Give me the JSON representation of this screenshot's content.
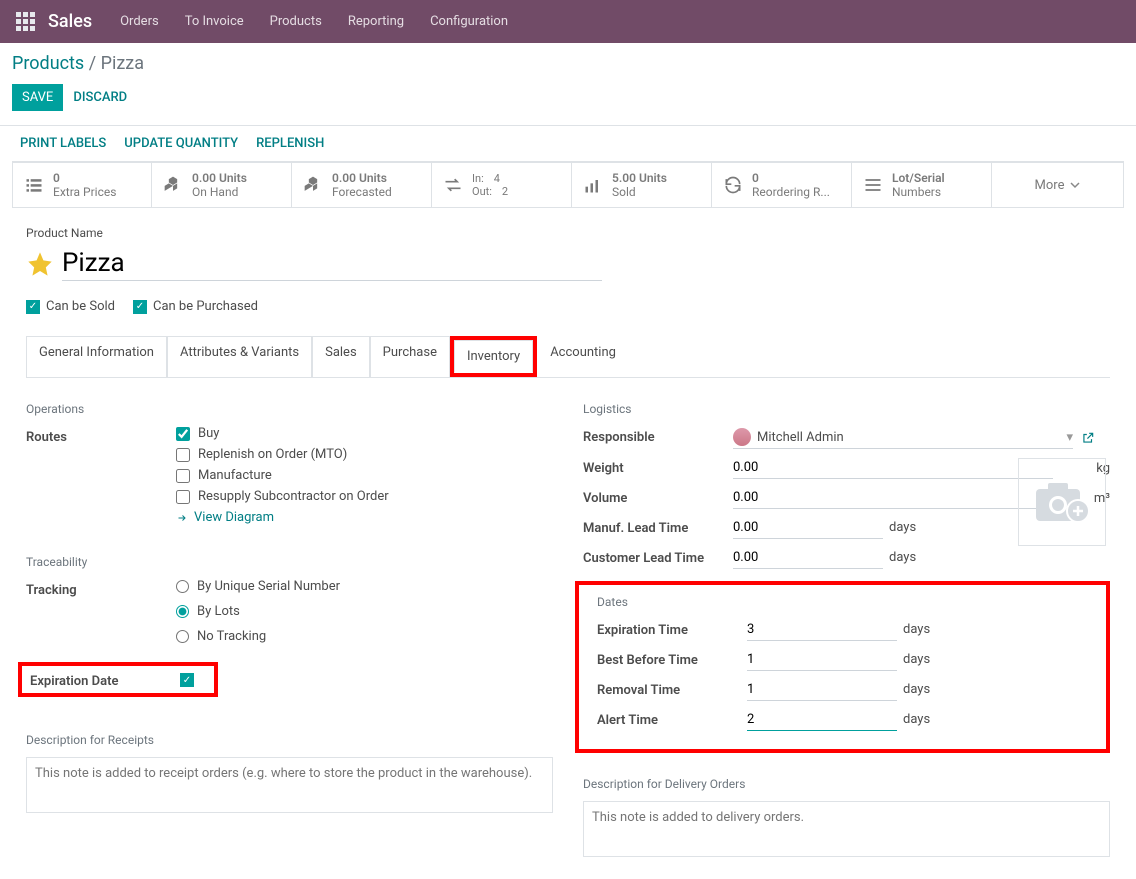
{
  "topbar": {
    "app_name": "Sales",
    "menu": [
      "Orders",
      "To Invoice",
      "Products",
      "Reporting",
      "Configuration"
    ]
  },
  "breadcrumb": {
    "parent": "Products",
    "current": "Pizza"
  },
  "buttons": {
    "save": "SAVE",
    "discard": "DISCARD"
  },
  "actions": {
    "print": "PRINT LABELS",
    "update": "UPDATE QUANTITY",
    "replenish": "REPLENISH"
  },
  "stats": {
    "extra_prices": {
      "v": "0",
      "l": "Extra Prices"
    },
    "on_hand": {
      "v": "0.00 Units",
      "l": "On Hand"
    },
    "forecasted": {
      "v": "0.00 Units",
      "l": "Forecasted"
    },
    "in_label": "In:",
    "in_v": "4",
    "out_label": "Out:",
    "out_v": "2",
    "sold": {
      "v": "5.00 Units",
      "l": "Sold"
    },
    "reorder": {
      "v": "0",
      "l": "Reordering R..."
    },
    "lot": {
      "v": "Lot/Serial",
      "l": "Numbers"
    },
    "more": "More"
  },
  "product": {
    "name_label": "Product Name",
    "name": "Pizza",
    "sold_label": "Can be Sold",
    "purchased_label": "Can be Purchased"
  },
  "tabs": [
    "General Information",
    "Attributes & Variants",
    "Sales",
    "Purchase",
    "Inventory",
    "Accounting"
  ],
  "operations": {
    "title": "Operations",
    "routes_label": "Routes",
    "buy": "Buy",
    "mto": "Replenish on Order (MTO)",
    "manufacture": "Manufacture",
    "resupply": "Resupply Subcontractor on Order",
    "view_diagram": "View Diagram"
  },
  "traceability": {
    "title": "Traceability",
    "tracking_label": "Tracking",
    "serial": "By Unique Serial Number",
    "lots": "By Lots",
    "none": "No Tracking",
    "exp_label": "Expiration Date"
  },
  "logistics": {
    "title": "Logistics",
    "responsible_label": "Responsible",
    "responsible": "Mitchell Admin",
    "weight_label": "Weight",
    "weight": "0.00",
    "weight_u": "kg",
    "volume_label": "Volume",
    "volume": "0.00",
    "volume_u": "m³",
    "manuf_label": "Manuf. Lead Time",
    "manuf": "0.00",
    "cust_label": "Customer Lead Time",
    "cust": "0.00",
    "days": "days"
  },
  "dates": {
    "title": "Dates",
    "exp_label": "Expiration Time",
    "exp": "3",
    "bb_label": "Best Before Time",
    "bb": "1",
    "rm_label": "Removal Time",
    "rm": "1",
    "al_label": "Alert Time",
    "al": "2",
    "days": "days"
  },
  "desc": {
    "receipts_title": "Description for Receipts",
    "receipts_ph": "This note is added to receipt orders (e.g. where to store the product in the warehouse).",
    "delivery_title": "Description for Delivery Orders",
    "delivery_ph": "This note is added to delivery orders."
  }
}
